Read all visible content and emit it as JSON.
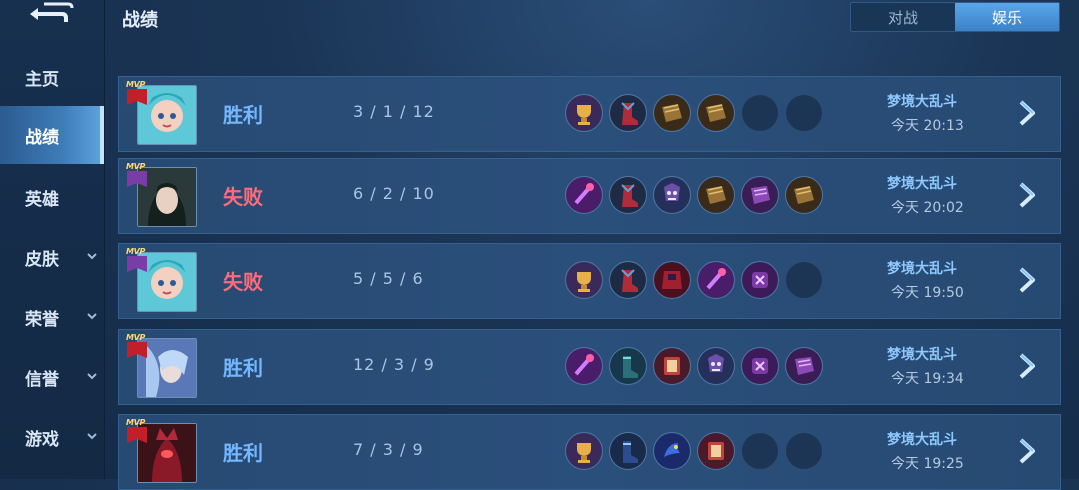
{
  "page": {
    "title": "战绩"
  },
  "toggle": {
    "options": [
      "对战",
      "娱乐"
    ],
    "selected": "娱乐"
  },
  "sidebar": {
    "items": [
      {
        "label": "主页",
        "active": false,
        "expandable": false
      },
      {
        "label": "战绩",
        "active": true,
        "expandable": false
      },
      {
        "label": "英雄",
        "active": false,
        "expandable": false
      },
      {
        "label": "皮肤",
        "active": false,
        "expandable": true
      },
      {
        "label": "荣誉",
        "active": false,
        "expandable": true
      },
      {
        "label": "信誉",
        "active": false,
        "expandable": true
      },
      {
        "label": "游戏",
        "active": false,
        "expandable": true
      }
    ]
  },
  "badge": {
    "text": "MVP"
  },
  "matches": [
    {
      "result": "胜利",
      "win": true,
      "kda": "3 / 1 / 12",
      "mode": "梦境大乱斗",
      "time": "今天 20:13",
      "mvp_color": "#c21f2a",
      "items": [
        "cup",
        "boots-red",
        "book",
        "book",
        "empty",
        "empty"
      ]
    },
    {
      "result": "失败",
      "win": false,
      "kda": "6 / 2 / 10",
      "mode": "梦境大乱斗",
      "time": "今天 20:02",
      "mvp_color": "#7a3da8",
      "items": [
        "wand",
        "boots-red",
        "skull",
        "book",
        "scroll",
        "book"
      ]
    },
    {
      "result": "失败",
      "win": false,
      "kda": "5 / 5 / 6",
      "mode": "梦境大乱斗",
      "time": "今天 19:50",
      "mvp_color": "#7a3da8",
      "items": [
        "cup",
        "boots-red",
        "cloak",
        "wand",
        "rune",
        "empty"
      ]
    },
    {
      "result": "胜利",
      "win": true,
      "kda": "12 / 3 / 9",
      "mode": "梦境大乱斗",
      "time": "今天 19:34",
      "mvp_color": "#c21f2a",
      "items": [
        "wand",
        "boots-teal",
        "tome",
        "skull",
        "rune",
        "scroll"
      ]
    },
    {
      "result": "胜利",
      "win": true,
      "kda": "7 / 3 / 9",
      "mode": "梦境大乱斗",
      "time": "今天 19:25",
      "mvp_color": "#c21f2a",
      "items": [
        "cup",
        "boots-blue",
        "dragon",
        "tome",
        "empty",
        "empty"
      ]
    }
  ]
}
